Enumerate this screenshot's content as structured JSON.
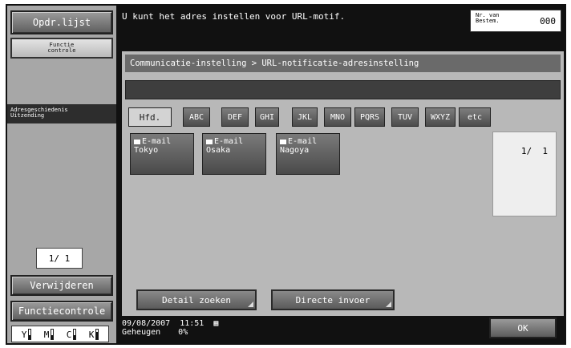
{
  "left_panel": {
    "job_list_label": "Opdr.lijst",
    "function_check_small": "Functie\ncontrole",
    "band_label": "Adresgeschiedenis\nUitzending",
    "page_indicator": "1/ 1",
    "delete_label": "Verwijderen",
    "function_check_label": "Functiecontrole",
    "toner": [
      {
        "letter": "Y",
        "level": 0.35
      },
      {
        "letter": "M",
        "level": 0.35
      },
      {
        "letter": "C",
        "level": 0.35
      },
      {
        "letter": "K",
        "level": 0.7
      }
    ]
  },
  "header": {
    "message": "U kunt het adres instellen voor URL-motif.",
    "counter_label": "Nr. van\nBestem.",
    "counter_value": "000"
  },
  "main": {
    "breadcrumb": "Communicatie-instelling > URL-notificatie-adresinstelling",
    "input_value": "",
    "tabs": [
      "Hfd.",
      "ABC",
      "DEF",
      "GHI",
      "JKL",
      "MNO",
      "PQRS",
      "TUV",
      "WXYZ",
      "etc"
    ],
    "active_tab": "Hfd.",
    "destinations": [
      {
        "type": "E-mail",
        "name": "Tokyo"
      },
      {
        "type": "E-mail",
        "name": "Osaka"
      },
      {
        "type": "E-mail",
        "name": "Nagoya"
      }
    ],
    "list_page": "1/  1",
    "detail_search_label": "Detail zoeken",
    "direct_input_label": "Directe invoer"
  },
  "status": {
    "date": "09/08/2007",
    "time": "11:51",
    "memory_label": "Geheugen",
    "memory_value": "0%",
    "ok_label": "OK"
  }
}
